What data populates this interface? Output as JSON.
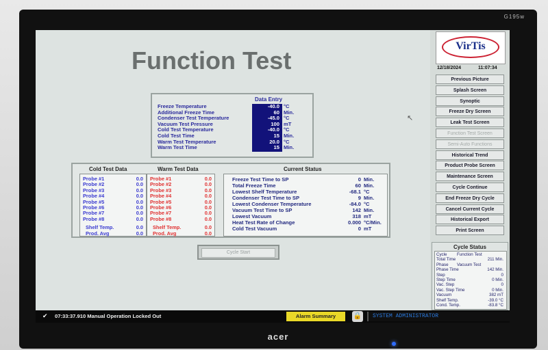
{
  "monitor": {
    "model": "G195w",
    "brand": "acer"
  },
  "title": "Function Test",
  "data_entry": {
    "header": "Data Entry",
    "rows": [
      {
        "label": "Freeze Temperature",
        "value": "-40.0",
        "unit": "°C"
      },
      {
        "label": "Additional Freeze Time",
        "value": "60",
        "unit": "Min."
      },
      {
        "label": "Condenser Test Temperature",
        "value": "-45.0",
        "unit": "°C"
      },
      {
        "label": "Vacuum Test Pressure",
        "value": "100",
        "unit": "mT"
      },
      {
        "label": "Cold Test Temperature",
        "value": "-40.0",
        "unit": "°C"
      },
      {
        "label": "Cold Test Time",
        "value": "15",
        "unit": "Min."
      },
      {
        "label": "Warm Test Temperature",
        "value": "20.0",
        "unit": "°C"
      },
      {
        "label": "Warm Test Time",
        "value": "15",
        "unit": "Min."
      }
    ]
  },
  "test_data": {
    "cold_header": "Cold Test Data",
    "warm_header": "Warm Test Data",
    "cold": [
      {
        "label": "Probe #1",
        "value": "0.0"
      },
      {
        "label": "Probe #2",
        "value": "0.0"
      },
      {
        "label": "Probe #3",
        "value": "0.0"
      },
      {
        "label": "Probe #4",
        "value": "0.0"
      },
      {
        "label": "Probe #5",
        "value": "0.0"
      },
      {
        "label": "Probe #6",
        "value": "0.0"
      },
      {
        "label": "Probe #7",
        "value": "0.0"
      },
      {
        "label": "Probe #8",
        "value": "0.0"
      },
      {
        "label": "Shelf Temp.",
        "value": "0.0"
      },
      {
        "label": "Prod. Avg",
        "value": "0.0"
      }
    ],
    "warm": [
      {
        "label": "Probe #1",
        "value": "0.0"
      },
      {
        "label": "Probe #2",
        "value": "0.0"
      },
      {
        "label": "Probe #3",
        "value": "0.0"
      },
      {
        "label": "Probe #4",
        "value": "0.0"
      },
      {
        "label": "Probe #5",
        "value": "0.0"
      },
      {
        "label": "Probe #6",
        "value": "0.0"
      },
      {
        "label": "Probe #7",
        "value": "0.0"
      },
      {
        "label": "Probe #8",
        "value": "0.0"
      },
      {
        "label": "Shelf Temp.",
        "value": "0.0"
      },
      {
        "label": "Prod. Avg",
        "value": "0.0"
      }
    ]
  },
  "current_status": {
    "header": "Current Status",
    "rows": [
      {
        "label": "Freeze Test Time to SP",
        "value": "0",
        "unit": "Min."
      },
      {
        "label": "Total Freeze Time",
        "value": "60",
        "unit": "Min."
      },
      {
        "label": "Lowest Shelf Temperature",
        "value": "-68.1",
        "unit": "°C"
      },
      {
        "label": "Condenser Test Time to SP",
        "value": "9",
        "unit": "Min."
      },
      {
        "label": "Lowest Condenser Temperature",
        "value": "-84.0",
        "unit": "°C"
      },
      {
        "label": "Vacuum Test Time to SP",
        "value": "142",
        "unit": "Min."
      },
      {
        "label": "Lowest Vacuum",
        "value": "318",
        "unit": "mT"
      },
      {
        "label": "Heat Test Rate of Change",
        "value": "0.000",
        "unit": "°C/Min."
      },
      {
        "label": "Cold Test Vacuum",
        "value": "0",
        "unit": "mT"
      }
    ]
  },
  "cycle_start": "Cycle Start",
  "sidebar": {
    "logo": "VirTis",
    "date": "12/18/2024",
    "time": "11:07:34",
    "buttons": [
      {
        "label": "Previous Picture",
        "enabled": true
      },
      {
        "label": "Splash Screen",
        "enabled": true
      },
      {
        "label": "Synoptic",
        "enabled": true
      },
      {
        "label": "Freeze Dry Screen",
        "enabled": true
      },
      {
        "label": "Leak Test Screen",
        "enabled": true
      },
      {
        "label": "Function Test Screen",
        "enabled": false
      },
      {
        "label": "Semi-Auto Functions",
        "enabled": false
      },
      {
        "label": "Historical Trend",
        "enabled": true
      },
      {
        "label": "Product Probe Screen",
        "enabled": true
      },
      {
        "label": "Maintenance Screen",
        "enabled": true
      },
      {
        "label": "Cycle Continue",
        "enabled": true
      },
      {
        "label": "End Freeze Dry Cycle",
        "enabled": true
      },
      {
        "label": "Cancel Current Cycle",
        "enabled": true
      },
      {
        "label": "Historical Export",
        "enabled": true
      },
      {
        "label": "Print Screen",
        "enabled": true
      }
    ]
  },
  "cycle_status": {
    "title": "Cycle Status",
    "rows": [
      {
        "label": "Cycle",
        "mid": "Function Test",
        "value": ""
      },
      {
        "label": "Total Time",
        "mid": "",
        "value": "211 Min."
      },
      {
        "label": "Phase",
        "mid": "Vacuum Test",
        "value": ""
      },
      {
        "label": "Phase Time",
        "mid": "",
        "value": "142 Min."
      },
      {
        "label": "Step",
        "mid": "",
        "value": "0"
      },
      {
        "label": "Step Time",
        "mid": "",
        "value": "0 Min."
      },
      {
        "label": "Vac. Step",
        "mid": "",
        "value": "0"
      },
      {
        "label": "Vac. Step Time",
        "mid": "",
        "value": "0 Min."
      },
      {
        "label": "Vacuum",
        "mid": "",
        "value": "382 mT"
      },
      {
        "label": "Shelf Temp.",
        "mid": "",
        "value": "-39.0 °C"
      },
      {
        "label": "Cond. Temp.",
        "mid": "",
        "value": "-83.8 °C"
      }
    ]
  },
  "bottom_bar": {
    "message": "07:33:37.910  Manual Operation Locked Out",
    "alarm_button": "Alarm Summary",
    "user": "SYSTEM ADMINISTRATOR"
  }
}
